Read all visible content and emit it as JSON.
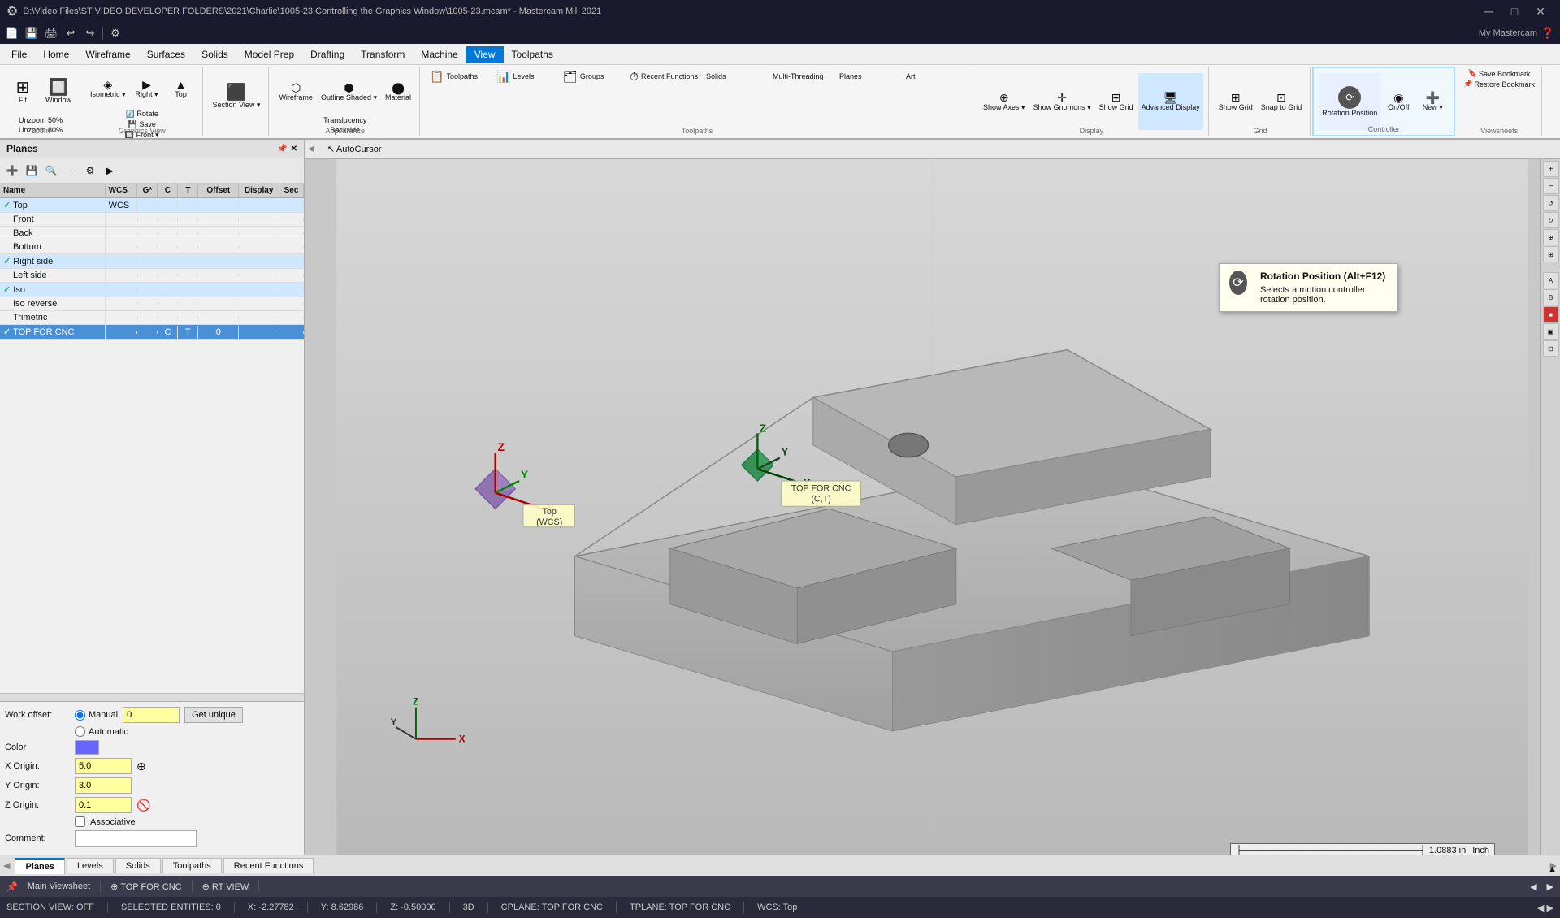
{
  "titlebar": {
    "filepath": "D:\\Video Files\\ST VIDEO DEVELOPER FOLDERS\\2021\\Charlie\\1005-23 Controlling the Graphics Window\\1005-23.mcam* - Mastercam Mill 2021",
    "app": "Mastercam Mill 2021",
    "shortpath": "1005-23.mcam*"
  },
  "qat": {
    "buttons": [
      "📄",
      "💾",
      "🖨",
      "↩",
      "↪",
      "⚙"
    ]
  },
  "menubar": {
    "items": [
      "File",
      "Home",
      "Wireframe",
      "Surfaces",
      "Solids",
      "Model Prep",
      "Drafting",
      "Transform",
      "Machine",
      "View",
      "Toolpaths"
    ]
  },
  "ribbon": {
    "active_tab": "View",
    "tabs": [
      "File",
      "Home",
      "Wireframe",
      "Surfaces",
      "Solids",
      "Model Prep",
      "Drafting",
      "Transform",
      "Machine",
      "View",
      "Toolpaths"
    ],
    "groups": {
      "zoom": {
        "label": "Zoom",
        "buttons": [
          "Fit",
          "Window"
        ],
        "small_buttons": [
          "Unzoom 50%",
          "Unzoom 80%"
        ]
      },
      "graphics_view": {
        "label": "Graphics View",
        "buttons": [
          "Isometric",
          "Right",
          "Top"
        ],
        "small_buttons": [
          "Rotate",
          "Save",
          "Front"
        ]
      },
      "section_view": {
        "label": "",
        "buttons": [
          "Section\nView"
        ]
      },
      "appearance": {
        "label": "Appearance",
        "buttons": [
          "Wireframe",
          "Outline\nShaded",
          "Material"
        ],
        "right_buttons": [
          "Translucency",
          "Backside"
        ]
      },
      "toolpaths": {
        "label": "Toolpaths",
        "buttons": [
          "Toolpaths",
          "Levels",
          "Groups",
          "Recent Functions",
          "Solids",
          "Multi-Threading",
          "Planes",
          "Art"
        ]
      },
      "display": {
        "label": "Display",
        "buttons": [
          "Show\nAxes",
          "Show\nGnomons",
          "Show\nGrid",
          "Advanced\nDisplay"
        ]
      },
      "grid": {
        "label": "Grid",
        "buttons": [
          "Show\nGrid",
          "Snap\nto Grid"
        ]
      },
      "controller": {
        "label": "Controller",
        "buttons": [
          "Rotation\nPosition",
          "On/Off",
          "New"
        ]
      },
      "viewsheets": {
        "label": "Viewsheets",
        "buttons": [
          "Save Bookmark",
          "Restore Bookmark"
        ]
      }
    }
  },
  "planes_panel": {
    "title": "Planes",
    "columns": [
      "Name",
      "WCS",
      "G*",
      "C",
      "T",
      "Offset",
      "Display",
      "Sec"
    ],
    "rows": [
      {
        "name": "Top",
        "wcs": "WCS",
        "indent": 0,
        "checked": true
      },
      {
        "name": "Front",
        "wcs": "",
        "indent": 1,
        "checked": false
      },
      {
        "name": "Back",
        "wcs": "",
        "indent": 1,
        "checked": false
      },
      {
        "name": "Bottom",
        "wcs": "",
        "indent": 1,
        "checked": false
      },
      {
        "name": "Right side",
        "wcs": "",
        "indent": 0,
        "checked": true
      },
      {
        "name": "Left side",
        "wcs": "",
        "indent": 1,
        "checked": false
      },
      {
        "name": "Iso",
        "wcs": "",
        "indent": 0,
        "checked": true
      },
      {
        "name": "Iso reverse",
        "wcs": "",
        "indent": 1,
        "checked": false
      },
      {
        "name": "Trimetric",
        "wcs": "",
        "indent": 1,
        "checked": false
      },
      {
        "name": "TOP FOR CNC",
        "wcs": "",
        "indent": 0,
        "checked": true,
        "c": "C",
        "t": "T",
        "offset": "0",
        "selected": true
      }
    ]
  },
  "properties": {
    "work_offset_label": "Work offset:",
    "work_offset_value": "0",
    "manual_label": "Manual",
    "automatic_label": "Automatic",
    "get_unique_label": "Get unique",
    "color_label": "Color",
    "x_origin_label": "X Origin:",
    "x_origin_value": "5.0",
    "y_origin_label": "Y Origin:",
    "y_origin_value": "3.0",
    "z_origin_label": "Z Origin:",
    "z_origin_value": "0.1",
    "associative_label": "Associative",
    "comment_label": "Comment:"
  },
  "viewport": {
    "labels": {
      "top_wcs": "Top\n(WCS)",
      "top_for_cnc": "TOP FOR CNC\n(C,T)"
    },
    "autocursor_label": "AutoCursor"
  },
  "tooltip": {
    "title": "Rotation Position (Alt+F12)",
    "description": "Selects a motion controller rotation position."
  },
  "bottom_tabs": {
    "items": [
      "Planes",
      "Levels",
      "Solids",
      "Toolpaths",
      "Recent Functions"
    ]
  },
  "statusbar": {
    "section_view": "SECTION VIEW: OFF",
    "selected": "SELECTED ENTITIES: 0",
    "x_coord": "X:  -2.27782",
    "y_coord": "Y:  8.62986",
    "z_coord": "Z:  -0.50000",
    "mode": "3D",
    "cplane": "CPLANE: TOP FOR CNC",
    "tplane": "TPLANE: TOP FOR CNC",
    "wcs": "WCS: Top"
  },
  "ruler": {
    "value": "1.0883 in",
    "unit": "Inch"
  }
}
